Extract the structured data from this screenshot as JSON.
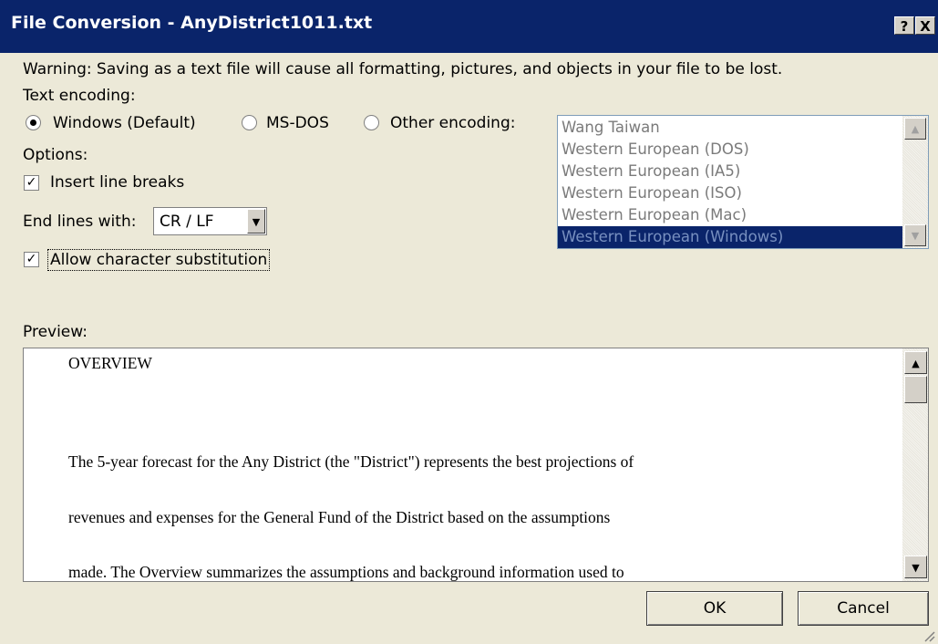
{
  "window": {
    "title": "File Conversion - AnyDistrict1011.txt",
    "help_label": "?",
    "close_label": "X"
  },
  "warning": "Warning: Saving as a text file will cause all formatting, pictures, and objects in your file to be lost.",
  "text_encoding": {
    "label": "Text encoding:",
    "options": [
      {
        "label": "Windows (Default)",
        "selected": true
      },
      {
        "label": "MS-DOS",
        "selected": false
      },
      {
        "label": "Other encoding:",
        "selected": false
      }
    ]
  },
  "options": {
    "label": "Options:",
    "insert_line_breaks": {
      "label": "Insert line breaks",
      "checked": true
    },
    "end_lines_label": "End lines with:",
    "end_lines_value": "CR / LF",
    "allow_substitution": {
      "label": "Allow character substitution",
      "checked": true
    }
  },
  "encoding_list": {
    "items": [
      "Wang Taiwan",
      "Western European (DOS)",
      "Western European (IA5)",
      "Western European (ISO)",
      "Western European (Mac)",
      "Western European (Windows)"
    ],
    "selected": "Western European (Windows)"
  },
  "preview": {
    "label": "Preview:",
    "lines": [
      "OVERVIEW",
      "The 5-year forecast for the Any District (the \"District\") represents the best projections of",
      "revenues and expenses for the General Fund of the District based on the assumptions",
      "made. The Overview summarizes the assumptions and background information used to"
    ]
  },
  "buttons": {
    "ok": "OK",
    "cancel": "Cancel"
  },
  "colors": {
    "titlebar": "#0a246a",
    "selection": "#0a246a",
    "dialog_bg": "#ece9d8"
  }
}
